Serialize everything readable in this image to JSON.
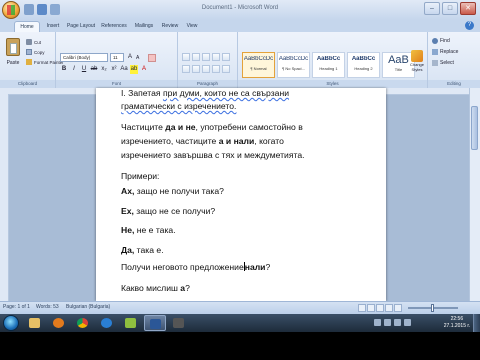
{
  "window": {
    "title": "Document1 - Microsoft Word"
  },
  "ribbon": {
    "tabs": [
      "Home",
      "Insert",
      "Page Layout",
      "References",
      "Mailings",
      "Review",
      "View"
    ],
    "groups": [
      "Clipboard",
      "Font",
      "Paragraph",
      "Styles",
      "Editing"
    ],
    "clipboard": {
      "paste": "Paste",
      "cut": "Cut",
      "copy": "Copy",
      "format_painter": "Format Painter"
    },
    "font": {
      "name": "Calibri (Body)",
      "size": "11"
    },
    "styles": [
      {
        "sample": "AaBbCcDc",
        "name": "¶ Normal"
      },
      {
        "sample": "AaBbCcDc",
        "name": "¶ No Spaci..."
      },
      {
        "sample": "AaBbCc",
        "name": "Heading 1"
      },
      {
        "sample": "AaBbCc",
        "name": "Heading 2"
      },
      {
        "sample": "AaB",
        "name": "Title"
      }
    ],
    "change_styles": "Change Styles",
    "editing": {
      "find": "Find",
      "replace": "Replace",
      "select": "Select"
    }
  },
  "document": {
    "l1a": "I. Запетая ",
    "l1b": "при думи, които не са свързани",
    "l2": "граматически с изречението.",
    "l3a": "Частиците ",
    "l3b": "да и не",
    "l3c": ", употребени самостойно в",
    "l4a": "изречението, частиците ",
    "l4b": "а и нали",
    "l4c": ", когато",
    "l5": "изречението завършва с тях и междуметията.",
    "examples": "Примери:",
    "ex1a": "Ах,",
    "ex1b": " защо не получи така?",
    "ex2a": "Ех,",
    "ex2b": " защо не се получи?",
    "ex3a": "Не,",
    "ex3b": " не е така.",
    "ex4a": "Да,",
    "ex4b": " така е.",
    "ex5a": "Получи неговото предложение",
    "ex5b": "нали",
    "ex5c": "?",
    "ex6a": "Какво мислиш ",
    "ex6b": "а",
    "ex6c": "?"
  },
  "status": {
    "page": "Page: 1 of 1",
    "words": "Words: 53",
    "language": "Bulgarian (Bulgaria)"
  },
  "taskbar": {
    "time": "22:56",
    "date": "27.1.2015 г."
  }
}
